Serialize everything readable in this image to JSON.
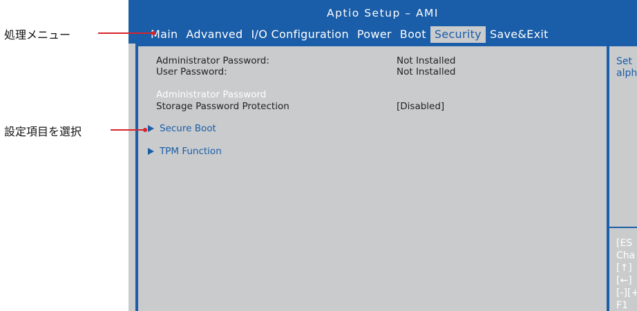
{
  "window": {
    "title": "Aptio Setup – AMI"
  },
  "menu": {
    "items": [
      {
        "label": "Main"
      },
      {
        "label": "Advanved"
      },
      {
        "label": "I/O Configuration"
      },
      {
        "label": "Power"
      },
      {
        "label": "Boot"
      },
      {
        "label": "Security"
      },
      {
        "label": "Save&Exit"
      }
    ],
    "active": "Security"
  },
  "settings": {
    "admin_password_label": "Administrator Password:",
    "admin_password_value": "Not Installed",
    "user_password_label": "User Password:",
    "user_password_value": "Not Installed",
    "admin_password_item": "Administrator Password",
    "storage_protection_label": "Storage Password Protection",
    "storage_protection_value": "[Disabled]",
    "secure_boot": "Secure Boot",
    "tpm_function": "TPM Function"
  },
  "help": {
    "line1": "Set",
    "line2": "alph",
    "keys": [
      "[ES",
      "Cha",
      "[↑]",
      "[←]",
      "[-][+",
      "F1"
    ]
  },
  "annotations": {
    "menu_label": "処理メニュー",
    "select_label": "設定項目を選択"
  },
  "colors": {
    "bios_blue": "#1a5da8",
    "bios_gray": "#c9cbcd",
    "annotation_red": "#d9232b"
  },
  "icons": {
    "submenu_marker": "right-triangle-icon"
  }
}
